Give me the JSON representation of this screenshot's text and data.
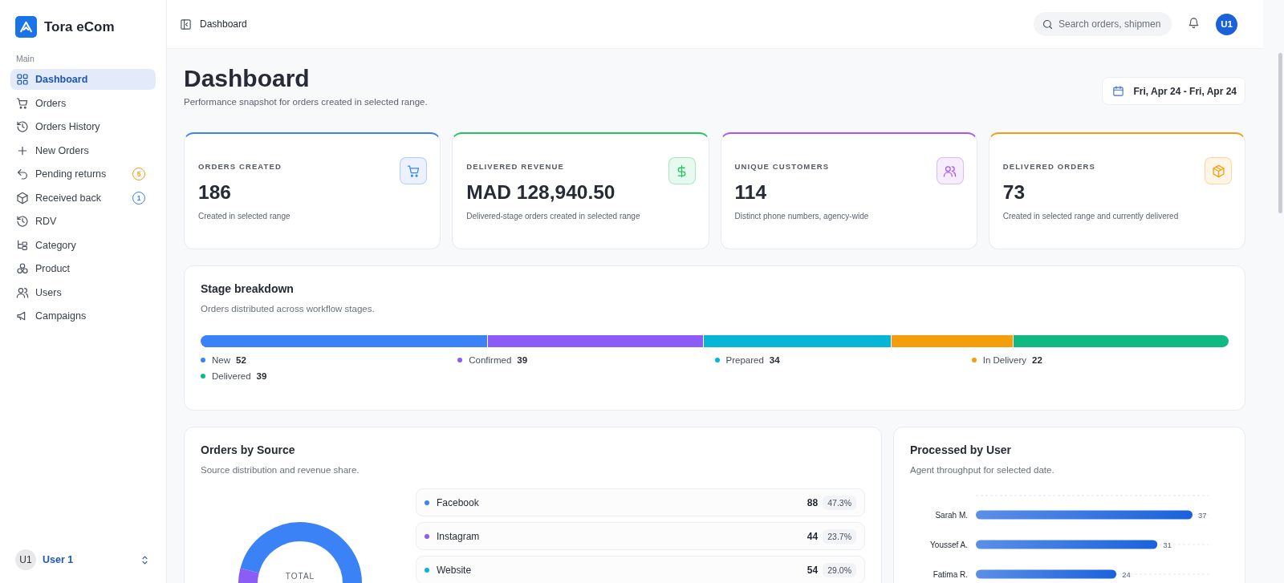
{
  "app": {
    "name": "Tora eCom"
  },
  "sidebar": {
    "section": "Main",
    "items": [
      {
        "label": "Dashboard",
        "selected": true
      },
      {
        "label": "Orders",
        "selected": false
      },
      {
        "label": "Orders History",
        "selected": false
      },
      {
        "label": "New Orders",
        "selected": false
      },
      {
        "label": "Pending returns",
        "selected": false,
        "badge": {
          "text": "5",
          "color": "#f59e0b"
        }
      },
      {
        "label": "Received back",
        "selected": false,
        "badge": {
          "text": "1",
          "color": "#3b82f6"
        }
      },
      {
        "label": "RDV",
        "selected": false
      },
      {
        "label": "Category",
        "selected": false
      },
      {
        "label": "Product",
        "selected": false
      },
      {
        "label": "Users",
        "selected": false
      },
      {
        "label": "Campaigns",
        "selected": false
      }
    ],
    "user": {
      "avatar": "U1",
      "name": "User 1"
    }
  },
  "topbar": {
    "breadcrumb": "Dashboard",
    "search": {
      "placeholder": "Search orders, shipmen"
    },
    "avatar": "U1"
  },
  "header": {
    "title": "Dashboard",
    "subtitle": "Performance snapshot for orders created in selected range.",
    "date_range": "Fri, Apr 24 - Fri, Apr 24"
  },
  "stats": [
    {
      "label": "ORDERS CREATED",
      "value": "186",
      "note": "Created in selected range",
      "color": "#3b82f6"
    },
    {
      "label": "DELIVERED REVENUE",
      "value": "MAD 128,940.50",
      "note": "Delivered-stage orders created in selected range",
      "color": "#22c55e"
    },
    {
      "label": "UNIQUE CUSTOMERS",
      "value": "114",
      "note": "Distinct phone numbers, agency-wide",
      "color": "#a855f7"
    },
    {
      "label": "DELIVERED ORDERS",
      "value": "73",
      "note": "Created in selected range and currently delivered",
      "color": "#f59e0b"
    }
  ],
  "stage_breakdown": {
    "title": "Stage breakdown",
    "subtitle": "Orders distributed across workflow stages.",
    "stages": [
      {
        "name": "New",
        "count": "52",
        "color": "#3b82f6"
      },
      {
        "name": "Confirmed",
        "count": "39",
        "color": "#8b5cf6"
      },
      {
        "name": "Prepared",
        "count": "34",
        "color": "#06b6d4"
      },
      {
        "name": "In Delivery",
        "count": "22",
        "color": "#f59e0b"
      },
      {
        "name": "Delivered",
        "count": "39",
        "color": "#10b981"
      }
    ]
  },
  "orders_by_source": {
    "title": "Orders by Source",
    "subtitle": "Source distribution and revenue share.",
    "total_label": "TOTAL",
    "sources": [
      {
        "name": "Facebook",
        "count": "88",
        "share": "47.3%",
        "color": "#3b82f6"
      },
      {
        "name": "Instagram",
        "count": "44",
        "share": "23.7%",
        "color": "#8b5cf6"
      },
      {
        "name": "Website",
        "count": "54",
        "share": "29.0%",
        "color": "#06b6d4"
      }
    ]
  },
  "processed_by_user": {
    "title": "Processed by User",
    "subtitle": "Agent throughput for selected date.",
    "chart_data": {
      "type": "bar",
      "orientation": "horizontal",
      "categories": [
        "Sarah M.",
        "Youssef A.",
        "Fatima R."
      ],
      "values": [
        37,
        31,
        24
      ],
      "data_labels": true
    }
  }
}
